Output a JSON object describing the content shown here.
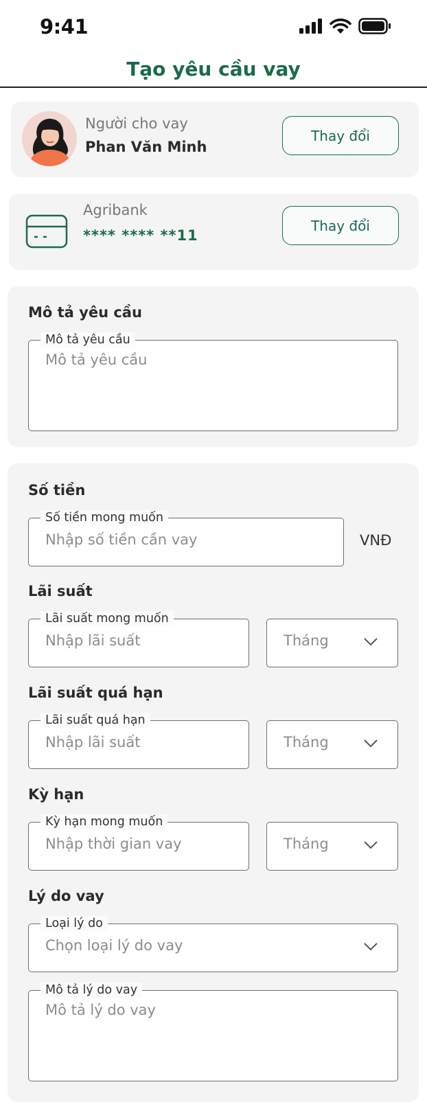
{
  "status_bar": {
    "time": "9:41"
  },
  "header": {
    "title": "Tạo yêu cầu vay"
  },
  "lender": {
    "label": "Người cho vay",
    "name": "Phan Văn Minh",
    "change_label": "Thay đổi"
  },
  "bank": {
    "name": "Agribank",
    "card_number": "**** **** **11",
    "change_label": "Thay đổi"
  },
  "description": {
    "section_title": "Mô tả yêu cầu",
    "legend": "Mô tả yêu cầu",
    "placeholder": "Mô tả yêu cầu"
  },
  "amount": {
    "section_title": "Số tiền",
    "legend": "Số tiền mong muốn",
    "placeholder": "Nhập số tiền cần vay",
    "unit": "VNĐ"
  },
  "interest": {
    "section_title": "Lãi suất",
    "legend": "Lãi suất mong muốn",
    "placeholder": "Nhập lãi suất",
    "period": "Tháng"
  },
  "overdue_interest": {
    "section_title": "Lãi suất quá hạn",
    "legend": "Lãi suất quá hạn",
    "placeholder": "Nhập lãi suất",
    "period": "Tháng"
  },
  "term": {
    "section_title": "Kỳ hạn",
    "legend": "Kỳ hạn mong muốn",
    "placeholder": "Nhập thời gian vay",
    "period": "Tháng"
  },
  "reason": {
    "section_title": "Lý do vay",
    "type_legend": "Loại lý do",
    "type_placeholder": "Chọn loại lý do vay",
    "desc_legend": "Mô tả lý do vay",
    "desc_placeholder": "Mô tả lý do vay"
  },
  "colors": {
    "brand": "#1b6b48",
    "card_bg": "#f4f4f4",
    "field_border": "#6e6e6e",
    "placeholder": "#8c8c8c"
  },
  "icons": [
    "signal-icon",
    "wifi-icon",
    "battery-icon",
    "bank-card-icon",
    "chevron-down-icon"
  ]
}
